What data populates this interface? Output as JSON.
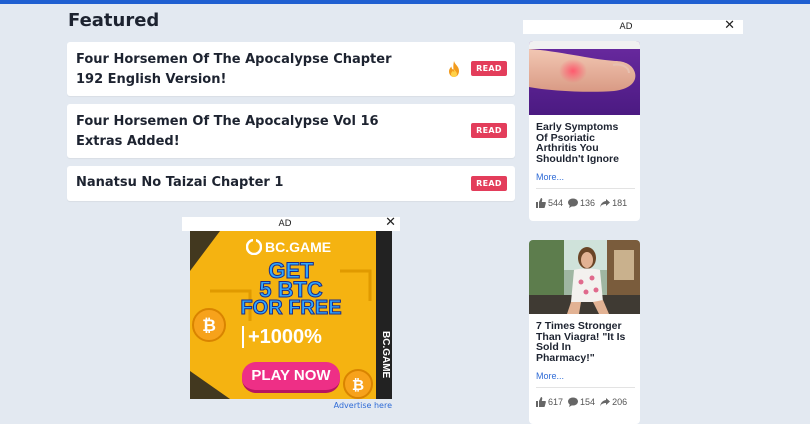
{
  "section": {
    "title": "Featured"
  },
  "featured": [
    {
      "title_line1": "Four Horsemen Of The Apocalypse Chapter",
      "title_line2": "192 English Version!",
      "badge": "READ",
      "hot": true
    },
    {
      "title_line1": "Four Horsemen Of The Apocalypse Vol 16",
      "title_line2": "Extras Added!",
      "badge": "READ",
      "hot": false
    },
    {
      "title_line1": "Nanatsu No Taizai Chapter 1",
      "title_line2": "",
      "badge": "READ",
      "hot": false
    }
  ],
  "bottom_ad": {
    "label": "AD",
    "close": "✕",
    "brand": "BC.GAME",
    "headline_1": "GET",
    "headline_2": "5 BTC",
    "headline_3": "FOR FREE",
    "bonus": "+1000%",
    "cta": "PLAY NOW",
    "side_brand": "BC.GAME",
    "advertise": "Advertise here"
  },
  "side_ad": {
    "label": "AD",
    "close": "✕"
  },
  "recommendations": [
    {
      "title_lines": [
        "Early Symptoms",
        "Of Psoriatic",
        "Arthritis You",
        "Shouldn't Ignore"
      ],
      "more": "More...",
      "likes": "544",
      "comments": "136",
      "shares": "181"
    },
    {
      "title_lines": [
        "7 Times Stronger",
        "Than Viagra! \"It Is",
        "Sold In",
        "Pharmacy!\""
      ],
      "more": "More...",
      "likes": "617",
      "comments": "154",
      "shares": "206"
    }
  ],
  "colors": {
    "accent": "#1f5fd1",
    "badge": "#e33d5b",
    "link": "#2f6bd6",
    "ad_bg": "#f5b311"
  },
  "icons": [
    "fire-icon",
    "close-icon",
    "thumbs-up-icon",
    "comment-icon",
    "share-icon",
    "bitcoin-icon"
  ]
}
